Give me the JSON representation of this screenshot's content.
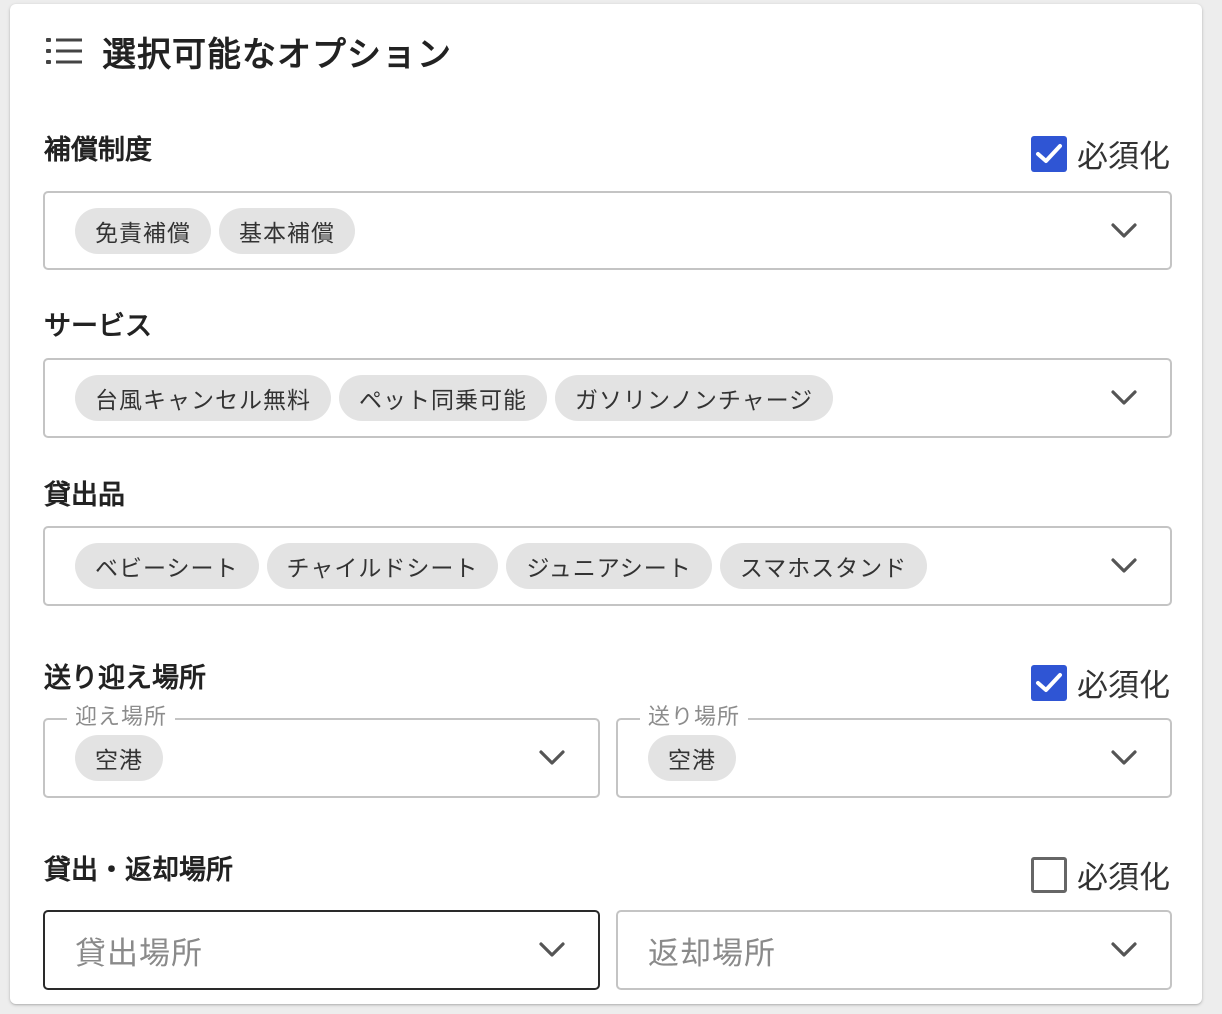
{
  "header": {
    "title": "選択可能なオプション",
    "icon": "list-icon"
  },
  "required_label": "必須化",
  "accent_color": "#2f55d4",
  "compensation": {
    "label": "補償制度",
    "required": true,
    "chips": [
      "免責補償",
      "基本補償"
    ]
  },
  "services": {
    "label": "サービス",
    "chips": [
      "台風キャンセル無料",
      "ペット同乗可能",
      "ガソリンノンチャージ"
    ]
  },
  "rentals": {
    "label": "貸出品",
    "chips": [
      "ベビーシート",
      "チャイルドシート",
      "ジュニアシート",
      "スマホスタンド"
    ]
  },
  "pickup": {
    "label": "送り迎え場所",
    "required": true,
    "pickup_field": {
      "legend": "迎え場所",
      "chip": "空港"
    },
    "dropoff_field": {
      "legend": "送り場所",
      "chip": "空港"
    }
  },
  "rental_return": {
    "label": "貸出・返却場所",
    "required": false,
    "rental_field": {
      "placeholder": "貸出場所"
    },
    "return_field": {
      "placeholder": "返却場所"
    }
  }
}
